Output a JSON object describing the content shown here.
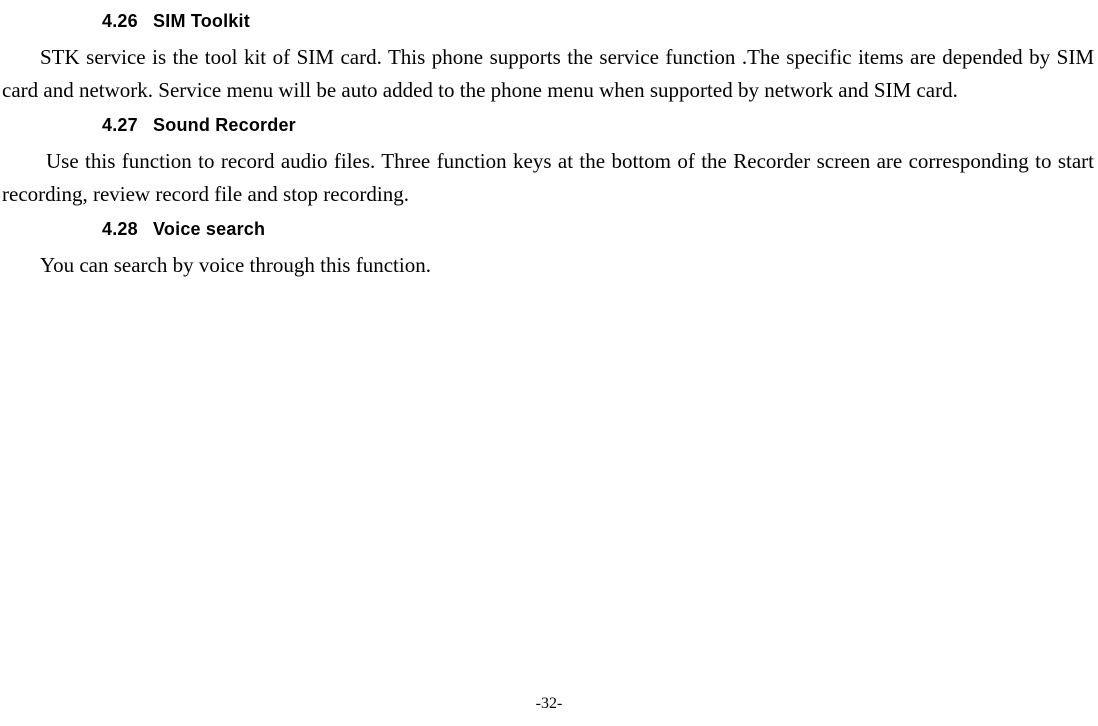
{
  "sections": [
    {
      "number": "4.26",
      "title": "SIM Toolkit",
      "body": "STK service is the tool kit of SIM card. This phone supports the service function .The specific items are depended by SIM card and network. Service menu will be auto added to the phone menu when supported by network and SIM card."
    },
    {
      "number": "4.27",
      "title": "Sound Recorder",
      "body": "Use this function to record audio files. Three function keys at the bottom of the Recorder screen are corresponding to start recording, review record file and stop recording."
    },
    {
      "number": "4.28",
      "title": "Voice search",
      "body": "You can search by voice through this function."
    }
  ],
  "page_number": "-32-"
}
